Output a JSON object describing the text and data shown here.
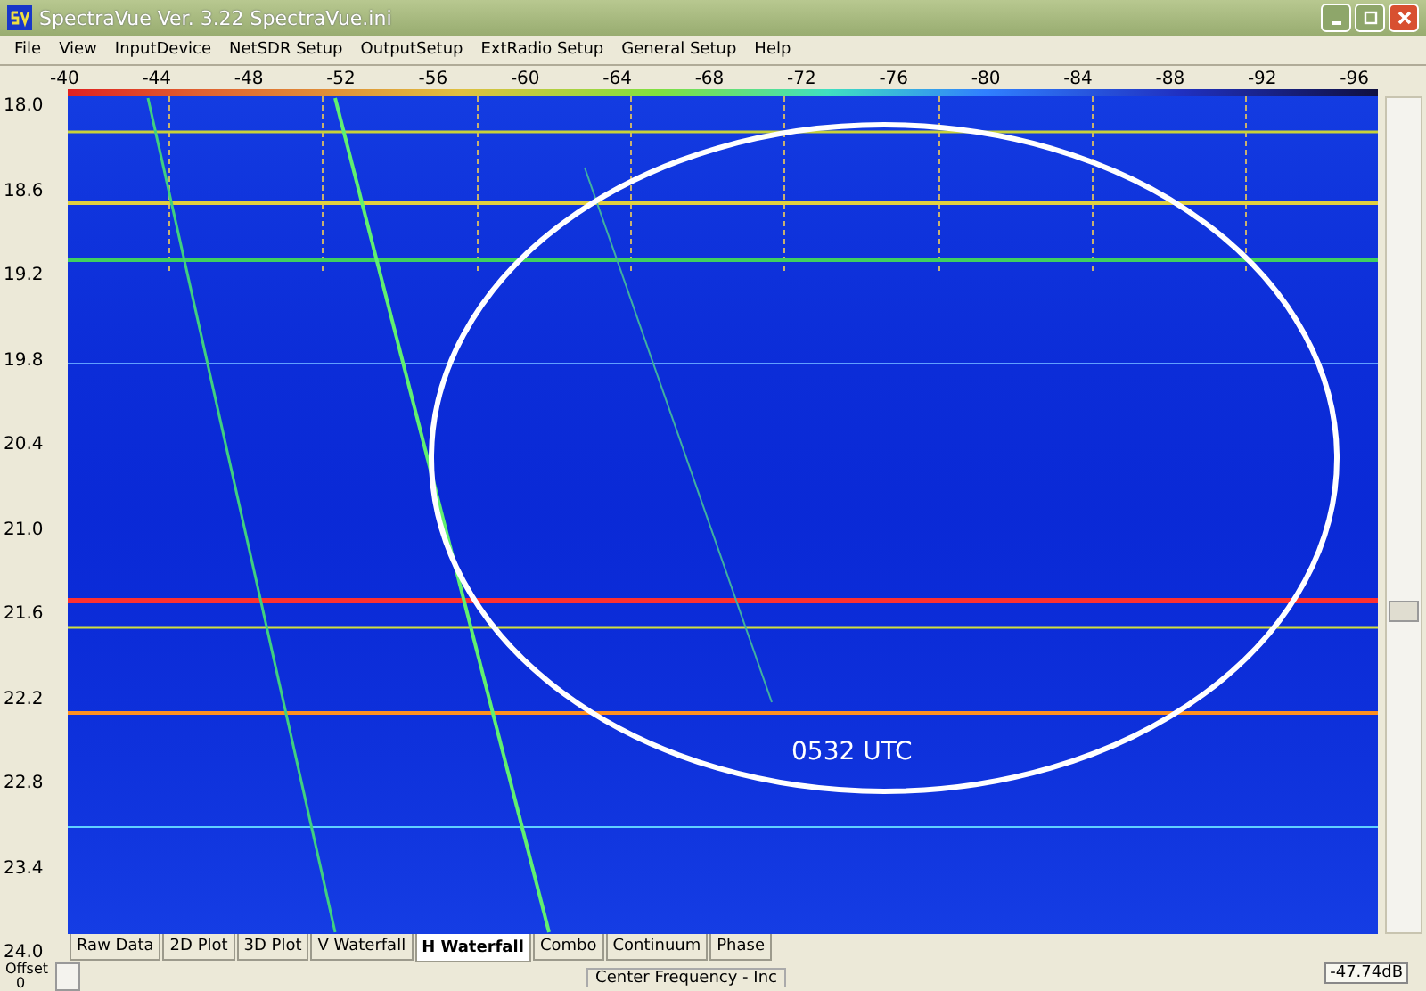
{
  "window": {
    "title": "SpectraVue Ver. 3.22 SpectraVue.ini"
  },
  "menu": [
    "File",
    "View",
    "InputDevice",
    "NetSDR Setup",
    "OutputSetup",
    "ExtRadio Setup",
    "General Setup",
    "Help"
  ],
  "x_axis": [
    "-40",
    "-44",
    "-48",
    "-52",
    "-56",
    "-60",
    "-64",
    "-68",
    "-72",
    "-76",
    "-80",
    "-84",
    "-88",
    "-92",
    "-96"
  ],
  "y_axis": [
    "18.0",
    "18.6",
    "19.2",
    "19.8",
    "20.4",
    "21.0",
    "21.6",
    "22.2",
    "22.8",
    "23.4",
    "24.0"
  ],
  "annotation": {
    "label": "0532 UTC"
  },
  "tabs": [
    {
      "label": "Raw Data",
      "selected": false
    },
    {
      "label": "2D Plot",
      "selected": false
    },
    {
      "label": "3D Plot",
      "selected": false
    },
    {
      "label": "V Waterfall",
      "selected": false
    },
    {
      "label": "H Waterfall",
      "selected": true
    },
    {
      "label": "Combo",
      "selected": false
    },
    {
      "label": "Continuum",
      "selected": false
    },
    {
      "label": "Phase",
      "selected": false
    }
  ],
  "status_bar": {
    "offset_label": "Offset",
    "offset_value": "0",
    "center_frequency": "Center Frequency - Inc",
    "level_reading": "-47.74dB"
  }
}
